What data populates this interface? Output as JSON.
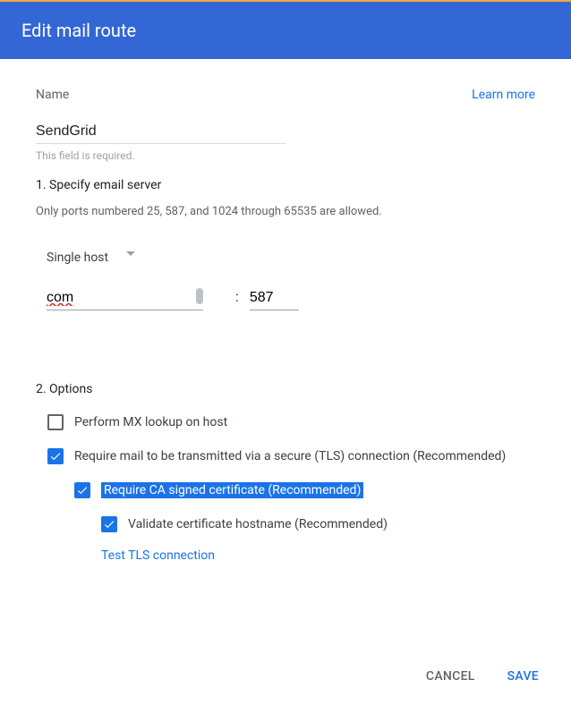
{
  "header": {
    "title": "Edit mail route"
  },
  "name": {
    "label": "Name",
    "learn_more": "Learn more",
    "value": "SendGrid",
    "helper": "This field is required."
  },
  "section1": {
    "title": "1. Specify email server",
    "hint": "Only ports numbered 25, 587, and 1024 through 65535 are allowed.",
    "dropdown": "Single host",
    "host_value": "com",
    "colon": ":",
    "port_value": "587"
  },
  "section2": {
    "title": "2. Options",
    "mx_lookup": "Perform MX lookup on host",
    "tls": "Require mail to be transmitted via a secure (TLS) connection (Recommended)",
    "ca_signed": "Require CA signed certificate (Recommended)",
    "validate_hostname": "Validate certificate hostname (Recommended)",
    "test_tls": "Test TLS connection"
  },
  "footer": {
    "cancel": "CANCEL",
    "save": "SAVE"
  }
}
